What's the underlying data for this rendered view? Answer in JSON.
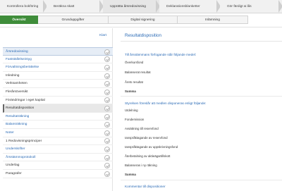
{
  "steps": [
    {
      "label": "Kontrollera bokföring",
      "active": false
    },
    {
      "label": "Beräkna skatt",
      "active": false
    },
    {
      "label": "Upprätta årsredovisning",
      "active": true
    },
    {
      "label": "Deklarationsblanketter",
      "active": false
    },
    {
      "label": "Gör färdigt & lås",
      "active": false
    }
  ],
  "tabs": [
    {
      "label": "Översikt",
      "active": true
    },
    {
      "label": "Grunduppgifter",
      "active": false
    },
    {
      "label": "Digital signering",
      "active": false
    },
    {
      "label": "Inlämning",
      "active": false
    }
  ],
  "sidebar": {
    "done_label": "Klart",
    "items": [
      {
        "label": "Årsredovisning",
        "style": "link-hl"
      },
      {
        "label": "Fastställelseintyg",
        "style": "link"
      },
      {
        "label": "Förvaltningsberättelse",
        "style": "link"
      },
      {
        "label": "Inledning",
        "style": "plain"
      },
      {
        "label": "Verksamheten",
        "style": "plain"
      },
      {
        "label": "Flerårsöversikt",
        "style": "plain"
      },
      {
        "label": "Förändringar i eget kapital",
        "style": "plain"
      },
      {
        "label": "Resultatdisposition",
        "style": "selected"
      },
      {
        "label": "Resultaträkning",
        "style": "link"
      },
      {
        "label": "Balansräkning",
        "style": "link"
      },
      {
        "label": "Noter",
        "style": "link"
      },
      {
        "label": "1 Redovisningsprinciper",
        "style": "plain"
      },
      {
        "label": "Underskrifter",
        "style": "link"
      },
      {
        "label": "Årsstämmoprotokoll",
        "style": "link"
      },
      {
        "label": "Underlag",
        "style": "plain"
      },
      {
        "label": "Paragrafer",
        "style": "plain"
      }
    ]
  },
  "main": {
    "title": "Resultatdisposition",
    "section1_heading": "Till årsstämmans förfogande står följande medel:",
    "section1_rows": [
      "Överkursfond",
      "Balanserat resultat",
      "Årets resultat"
    ],
    "section1_sum": "Summa",
    "section2_heading": "Styrelsen föreslår att medlen disponeras enligt följande:",
    "section2_rows": [
      "Utdelning",
      "Fondemission",
      "Avsättning till reservfond",
      "Ianspråktagande av reservfond",
      "Ianspråktagande av uppskrivningsfond",
      "Återbetalning av aktieägartillskott",
      "Balanseras i ny räkning"
    ],
    "section2_sum": "Summa",
    "comment_heading": "Kommentar till dispositioner"
  },
  "colors": {
    "accent_green": "#3f8d3a",
    "link_blue": "#2a6ab5"
  }
}
